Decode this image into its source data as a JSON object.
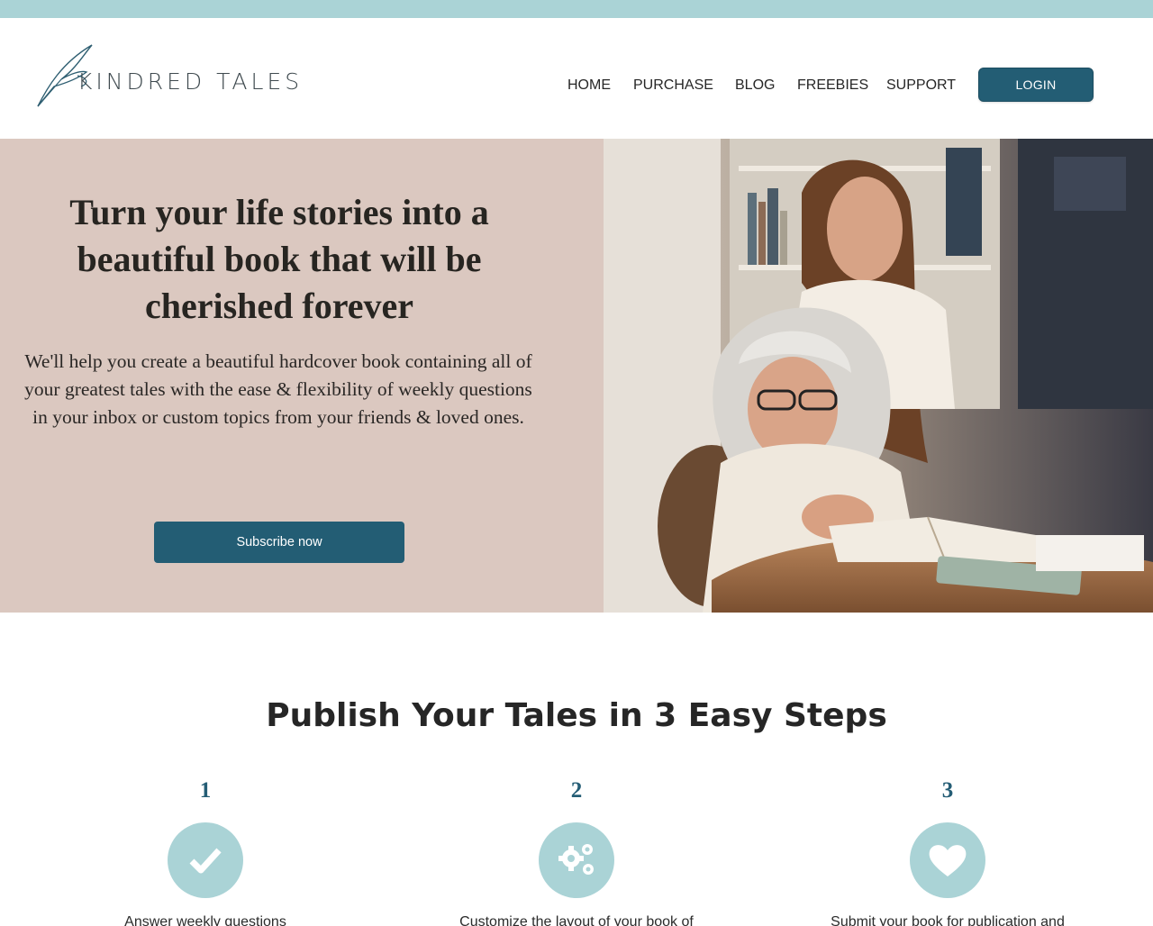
{
  "brand": {
    "name": "KINDRED TALES"
  },
  "nav": {
    "items": [
      {
        "label": "HOME"
      },
      {
        "label": "PURCHASE"
      },
      {
        "label": "BLOG"
      },
      {
        "label": "FREEBIES"
      },
      {
        "label": "SUPPORT"
      }
    ],
    "login_label": "LOGIN"
  },
  "hero": {
    "title": "Turn your life stories into a beautiful book that will be cherished forever",
    "body": "We'll help you create a beautiful hardcover book containing all of your greatest tales with the ease & flexibility of weekly questions in your inbox or custom topics from your friends & loved ones.",
    "cta_label": "Subscribe now",
    "image_alt": "grandmother-and-granddaughter-reading-photo"
  },
  "steps_section": {
    "title": "Publish Your Tales in 3 Easy Steps",
    "steps": [
      {
        "number": "1",
        "icon": "checkmark-icon",
        "text": "Answer weekly questions"
      },
      {
        "number": "2",
        "icon": "gears-icon",
        "text": "Customize the layout of your book of"
      },
      {
        "number": "3",
        "icon": "heart-icon",
        "text": "Submit your book for publication and"
      }
    ]
  },
  "colors": {
    "accent_teal": "#235d74",
    "light_teal": "#aad3d6",
    "hero_bg": "#dbc8c0",
    "nav_text": "#245d75"
  }
}
